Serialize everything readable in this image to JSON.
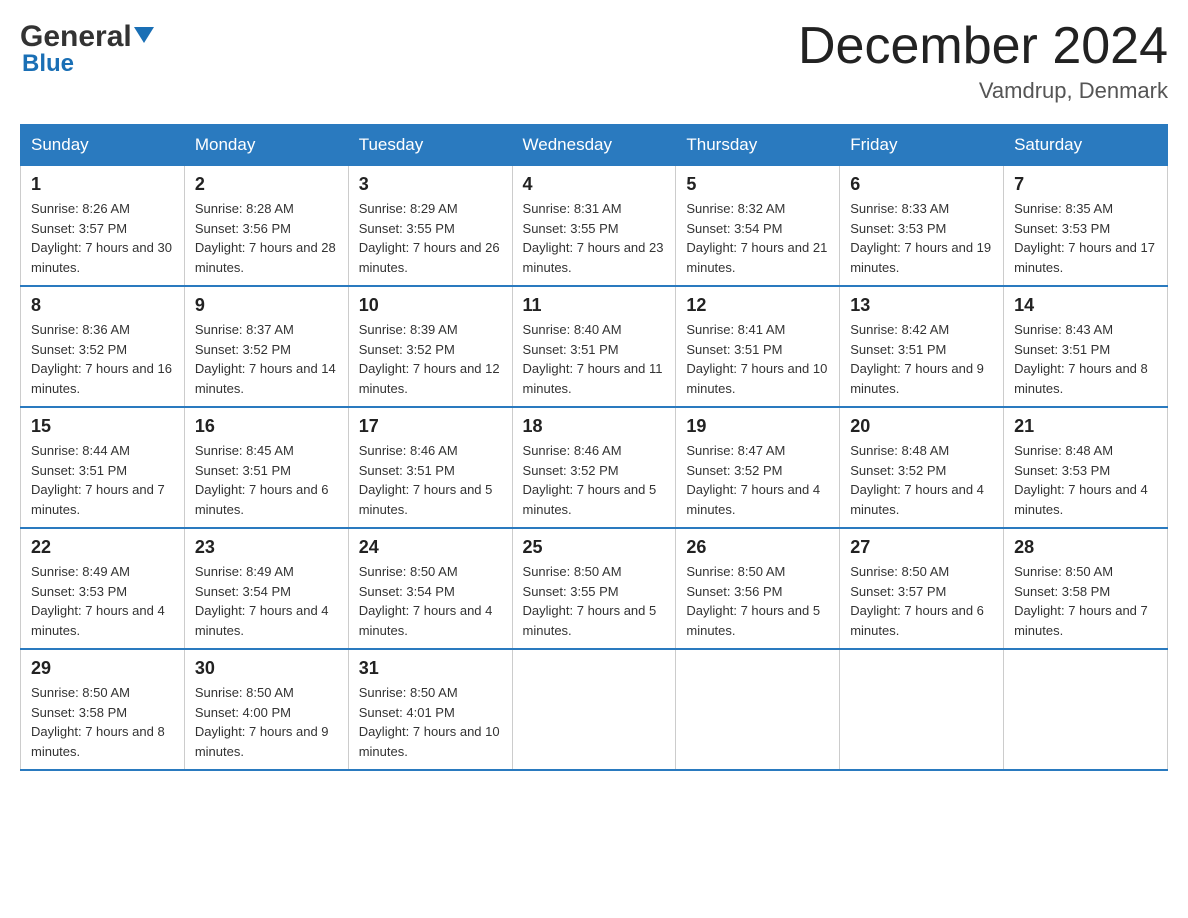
{
  "header": {
    "logo_general": "General",
    "logo_blue": "Blue",
    "title": "December 2024",
    "subtitle": "Vamdrup, Denmark"
  },
  "days_of_week": [
    "Sunday",
    "Monday",
    "Tuesday",
    "Wednesday",
    "Thursday",
    "Friday",
    "Saturday"
  ],
  "weeks": [
    [
      {
        "day": "1",
        "sunrise": "Sunrise: 8:26 AM",
        "sunset": "Sunset: 3:57 PM",
        "daylight": "Daylight: 7 hours and 30 minutes."
      },
      {
        "day": "2",
        "sunrise": "Sunrise: 8:28 AM",
        "sunset": "Sunset: 3:56 PM",
        "daylight": "Daylight: 7 hours and 28 minutes."
      },
      {
        "day": "3",
        "sunrise": "Sunrise: 8:29 AM",
        "sunset": "Sunset: 3:55 PM",
        "daylight": "Daylight: 7 hours and 26 minutes."
      },
      {
        "day": "4",
        "sunrise": "Sunrise: 8:31 AM",
        "sunset": "Sunset: 3:55 PM",
        "daylight": "Daylight: 7 hours and 23 minutes."
      },
      {
        "day": "5",
        "sunrise": "Sunrise: 8:32 AM",
        "sunset": "Sunset: 3:54 PM",
        "daylight": "Daylight: 7 hours and 21 minutes."
      },
      {
        "day": "6",
        "sunrise": "Sunrise: 8:33 AM",
        "sunset": "Sunset: 3:53 PM",
        "daylight": "Daylight: 7 hours and 19 minutes."
      },
      {
        "day": "7",
        "sunrise": "Sunrise: 8:35 AM",
        "sunset": "Sunset: 3:53 PM",
        "daylight": "Daylight: 7 hours and 17 minutes."
      }
    ],
    [
      {
        "day": "8",
        "sunrise": "Sunrise: 8:36 AM",
        "sunset": "Sunset: 3:52 PM",
        "daylight": "Daylight: 7 hours and 16 minutes."
      },
      {
        "day": "9",
        "sunrise": "Sunrise: 8:37 AM",
        "sunset": "Sunset: 3:52 PM",
        "daylight": "Daylight: 7 hours and 14 minutes."
      },
      {
        "day": "10",
        "sunrise": "Sunrise: 8:39 AM",
        "sunset": "Sunset: 3:52 PM",
        "daylight": "Daylight: 7 hours and 12 minutes."
      },
      {
        "day": "11",
        "sunrise": "Sunrise: 8:40 AM",
        "sunset": "Sunset: 3:51 PM",
        "daylight": "Daylight: 7 hours and 11 minutes."
      },
      {
        "day": "12",
        "sunrise": "Sunrise: 8:41 AM",
        "sunset": "Sunset: 3:51 PM",
        "daylight": "Daylight: 7 hours and 10 minutes."
      },
      {
        "day": "13",
        "sunrise": "Sunrise: 8:42 AM",
        "sunset": "Sunset: 3:51 PM",
        "daylight": "Daylight: 7 hours and 9 minutes."
      },
      {
        "day": "14",
        "sunrise": "Sunrise: 8:43 AM",
        "sunset": "Sunset: 3:51 PM",
        "daylight": "Daylight: 7 hours and 8 minutes."
      }
    ],
    [
      {
        "day": "15",
        "sunrise": "Sunrise: 8:44 AM",
        "sunset": "Sunset: 3:51 PM",
        "daylight": "Daylight: 7 hours and 7 minutes."
      },
      {
        "day": "16",
        "sunrise": "Sunrise: 8:45 AM",
        "sunset": "Sunset: 3:51 PM",
        "daylight": "Daylight: 7 hours and 6 minutes."
      },
      {
        "day": "17",
        "sunrise": "Sunrise: 8:46 AM",
        "sunset": "Sunset: 3:51 PM",
        "daylight": "Daylight: 7 hours and 5 minutes."
      },
      {
        "day": "18",
        "sunrise": "Sunrise: 8:46 AM",
        "sunset": "Sunset: 3:52 PM",
        "daylight": "Daylight: 7 hours and 5 minutes."
      },
      {
        "day": "19",
        "sunrise": "Sunrise: 8:47 AM",
        "sunset": "Sunset: 3:52 PM",
        "daylight": "Daylight: 7 hours and 4 minutes."
      },
      {
        "day": "20",
        "sunrise": "Sunrise: 8:48 AM",
        "sunset": "Sunset: 3:52 PM",
        "daylight": "Daylight: 7 hours and 4 minutes."
      },
      {
        "day": "21",
        "sunrise": "Sunrise: 8:48 AM",
        "sunset": "Sunset: 3:53 PM",
        "daylight": "Daylight: 7 hours and 4 minutes."
      }
    ],
    [
      {
        "day": "22",
        "sunrise": "Sunrise: 8:49 AM",
        "sunset": "Sunset: 3:53 PM",
        "daylight": "Daylight: 7 hours and 4 minutes."
      },
      {
        "day": "23",
        "sunrise": "Sunrise: 8:49 AM",
        "sunset": "Sunset: 3:54 PM",
        "daylight": "Daylight: 7 hours and 4 minutes."
      },
      {
        "day": "24",
        "sunrise": "Sunrise: 8:50 AM",
        "sunset": "Sunset: 3:54 PM",
        "daylight": "Daylight: 7 hours and 4 minutes."
      },
      {
        "day": "25",
        "sunrise": "Sunrise: 8:50 AM",
        "sunset": "Sunset: 3:55 PM",
        "daylight": "Daylight: 7 hours and 5 minutes."
      },
      {
        "day": "26",
        "sunrise": "Sunrise: 8:50 AM",
        "sunset": "Sunset: 3:56 PM",
        "daylight": "Daylight: 7 hours and 5 minutes."
      },
      {
        "day": "27",
        "sunrise": "Sunrise: 8:50 AM",
        "sunset": "Sunset: 3:57 PM",
        "daylight": "Daylight: 7 hours and 6 minutes."
      },
      {
        "day": "28",
        "sunrise": "Sunrise: 8:50 AM",
        "sunset": "Sunset: 3:58 PM",
        "daylight": "Daylight: 7 hours and 7 minutes."
      }
    ],
    [
      {
        "day": "29",
        "sunrise": "Sunrise: 8:50 AM",
        "sunset": "Sunset: 3:58 PM",
        "daylight": "Daylight: 7 hours and 8 minutes."
      },
      {
        "day": "30",
        "sunrise": "Sunrise: 8:50 AM",
        "sunset": "Sunset: 4:00 PM",
        "daylight": "Daylight: 7 hours and 9 minutes."
      },
      {
        "day": "31",
        "sunrise": "Sunrise: 8:50 AM",
        "sunset": "Sunset: 4:01 PM",
        "daylight": "Daylight: 7 hours and 10 minutes."
      },
      {
        "day": "",
        "sunrise": "",
        "sunset": "",
        "daylight": ""
      },
      {
        "day": "",
        "sunrise": "",
        "sunset": "",
        "daylight": ""
      },
      {
        "day": "",
        "sunrise": "",
        "sunset": "",
        "daylight": ""
      },
      {
        "day": "",
        "sunrise": "",
        "sunset": "",
        "daylight": ""
      }
    ]
  ]
}
